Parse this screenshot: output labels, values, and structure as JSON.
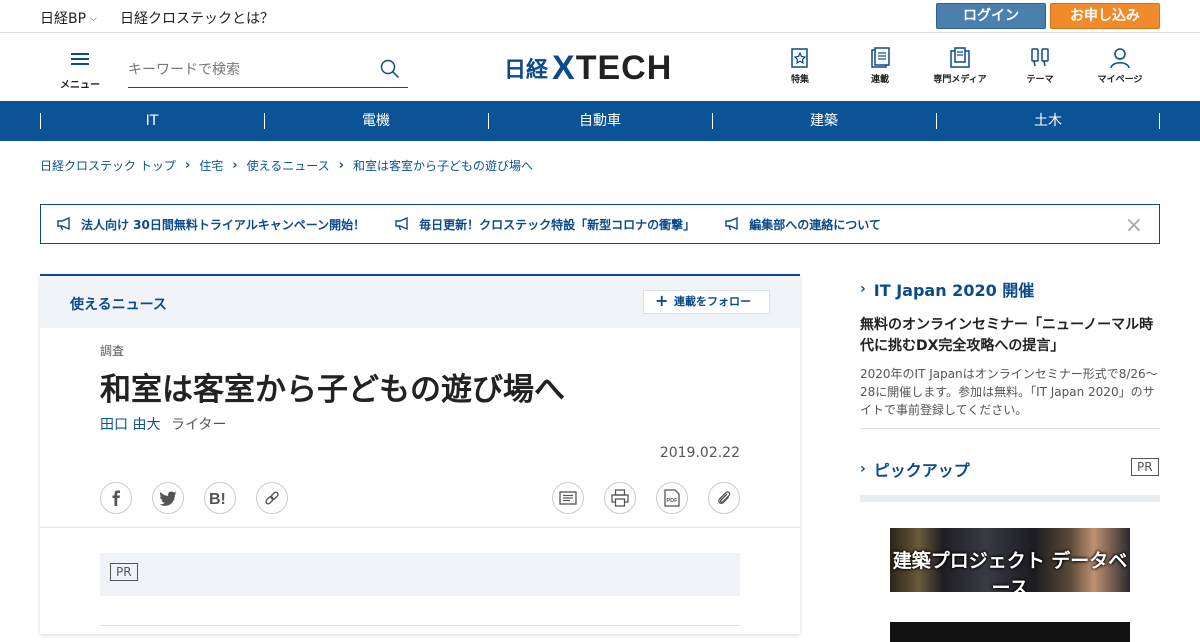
{
  "topbar": {
    "brand_link": "日経BP",
    "about_link": "日経クロステックとは？",
    "login": "ログイン",
    "apply": "お申し込み"
  },
  "header": {
    "menu_label": "メニュー",
    "search_placeholder": "キーワードで検索",
    "logo_prefix": "日経",
    "logo_x": "X",
    "logo_tech": "TECH",
    "nav": [
      "特集",
      "連載",
      "専門メディア",
      "テーマ",
      "マイページ"
    ]
  },
  "categories": [
    "IT",
    "電機",
    "自動車",
    "建築",
    "土木"
  ],
  "breadcrumb": [
    "日経クロステック トップ",
    "住宅",
    "使えるニュース",
    "和室は客室から子どもの遊び場へ"
  ],
  "notice": {
    "items": [
      "法人向け 30日間無料トライアルキャンペーン開始！",
      "毎日更新！クロステック特設「新型コロナの衝撃」",
      "編集部への連絡について"
    ],
    "close": "×"
  },
  "article": {
    "series": "使えるニュース",
    "follow": "連載をフォロー",
    "kicker": "調査",
    "title": "和室は客室から子どもの遊び場へ",
    "author": "田口 由大",
    "author_role": "ライター",
    "date": "2019.02.22",
    "share_icons": [
      "facebook-icon",
      "twitter-icon",
      "hatena-bookmark-icon",
      "link-icon"
    ],
    "tool_icons": [
      "comment-icon",
      "print-icon",
      "pdf-icon",
      "clip-icon"
    ],
    "pr_label": "PR"
  },
  "sidebar": {
    "event_heading": "IT Japan 2020 開催",
    "event_title": "無料のオンラインセミナー「ニューノーマル時代に挑むDX完全攻略への提言」",
    "event_desc": "2020年のIT Japanはオンラインセミナー形式で8/26～28に開催します。参加は無料。「IT Japan 2020」のサイトで事前登録してください。",
    "pickup_heading": "ピックアップ",
    "pr_label": "PR",
    "banner_text": "建築プロジェクト データベース"
  },
  "colors": {
    "brand_blue": "#0b4a8b",
    "category_bar": "#0b5394",
    "login_button": "#4a7fae",
    "apply_button": "#f08a2a"
  }
}
